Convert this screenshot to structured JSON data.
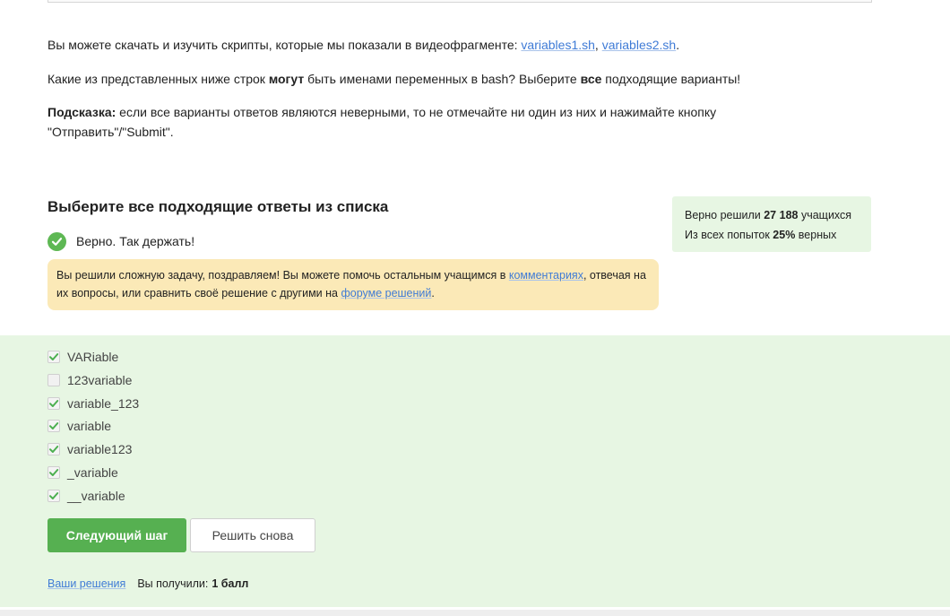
{
  "intro": {
    "text_before": "Вы можете скачать и изучить скрипты, которые мы показали в видеофрагменте: ",
    "link1": "variables1.sh",
    "separator": ", ",
    "link2": "variables2.sh",
    "text_after": "."
  },
  "question": {
    "part1": "Какие из представленных ниже строк ",
    "bold1": "могут",
    "part2": " быть именами переменных в bash? Выберите ",
    "bold2": "все",
    "part3": " подходящие варианты!"
  },
  "tip": {
    "label": "Подсказка:",
    "text": " если все варианты ответов являются неверными, то не отмечайте ни один из них и нажимайте кнопку \"Отправить\"/\"Submit\"."
  },
  "quiz": {
    "title": "Выберите все подходящие ответы из списка",
    "status": "Верно. Так держать!"
  },
  "stats": {
    "solved_prefix": "Верно решили ",
    "solved_count": "27 188",
    "solved_suffix": " учащихся",
    "attempts_prefix": "Из всех попыток ",
    "attempts_percent": "25%",
    "attempts_suffix": " верных"
  },
  "congrats": {
    "part1": "Вы решили сложную задачу, поздравляем! Вы можете помочь остальным учащимся в ",
    "link1": "комментариях",
    "part2": ", отвечая на их вопросы, или сравнить своё решение с другими на ",
    "link2": "форуме решений",
    "part3": "."
  },
  "options": [
    {
      "label": "VARiable",
      "checked": true
    },
    {
      "label": "123variable",
      "checked": false
    },
    {
      "label": "variable_123",
      "checked": true
    },
    {
      "label": "variable",
      "checked": true
    },
    {
      "label": "variable123",
      "checked": true
    },
    {
      "label": "_variable",
      "checked": true
    },
    {
      "label": "__variable",
      "checked": true
    }
  ],
  "buttons": {
    "next": "Следующий шаг",
    "retry": "Решить снова"
  },
  "footer": {
    "solutions_link": "Ваши решения",
    "score_label": "Вы получили:",
    "score_value": "1 балл"
  },
  "colors": {
    "accent_green": "#56b051",
    "success_bg": "#e7f6e3",
    "hint_bg": "#fbe9b7",
    "link": "#3f7bd6"
  }
}
